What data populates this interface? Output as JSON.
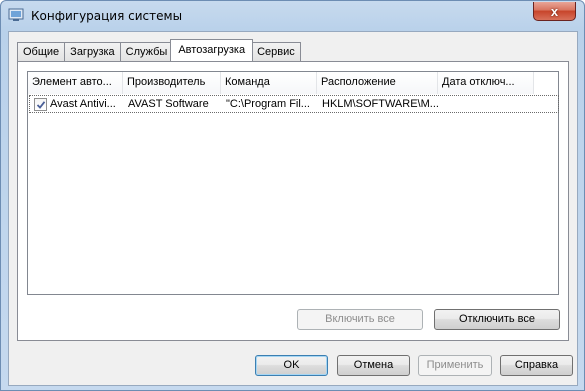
{
  "window": {
    "title": "Конфигурация системы",
    "close_label": "x"
  },
  "tabs": [
    {
      "label": "Общие"
    },
    {
      "label": "Загрузка"
    },
    {
      "label": "Службы"
    },
    {
      "label": "Автозагрузка",
      "active": true
    },
    {
      "label": "Сервис"
    }
  ],
  "startup_list": {
    "columns": [
      "Элемент авто...",
      "Производитель",
      "Команда",
      "Расположение",
      "Дата отключ..."
    ],
    "rows": [
      {
        "checked": true,
        "item": "Avast Antivi...",
        "manufacturer": "AVAST Software",
        "command": "\"C:\\Program Fil...",
        "location": "HKLM\\SOFTWARE\\M...",
        "date_disabled": ""
      }
    ]
  },
  "panel_buttons": {
    "enable_all": "Включить все",
    "disable_all": "Отключить все"
  },
  "dialog_buttons": {
    "ok": "OK",
    "cancel": "Отмена",
    "apply": "Применить",
    "help": "Справка"
  },
  "colors": {
    "title_bar": "#b9d1ea",
    "client_bg": "#f0f0f0",
    "close_button": "#c7442a",
    "default_button_border": "#3c7fb1"
  },
  "icons": {
    "app_icon": "system-config-icon",
    "checkbox_mark": "checkmark-icon"
  }
}
